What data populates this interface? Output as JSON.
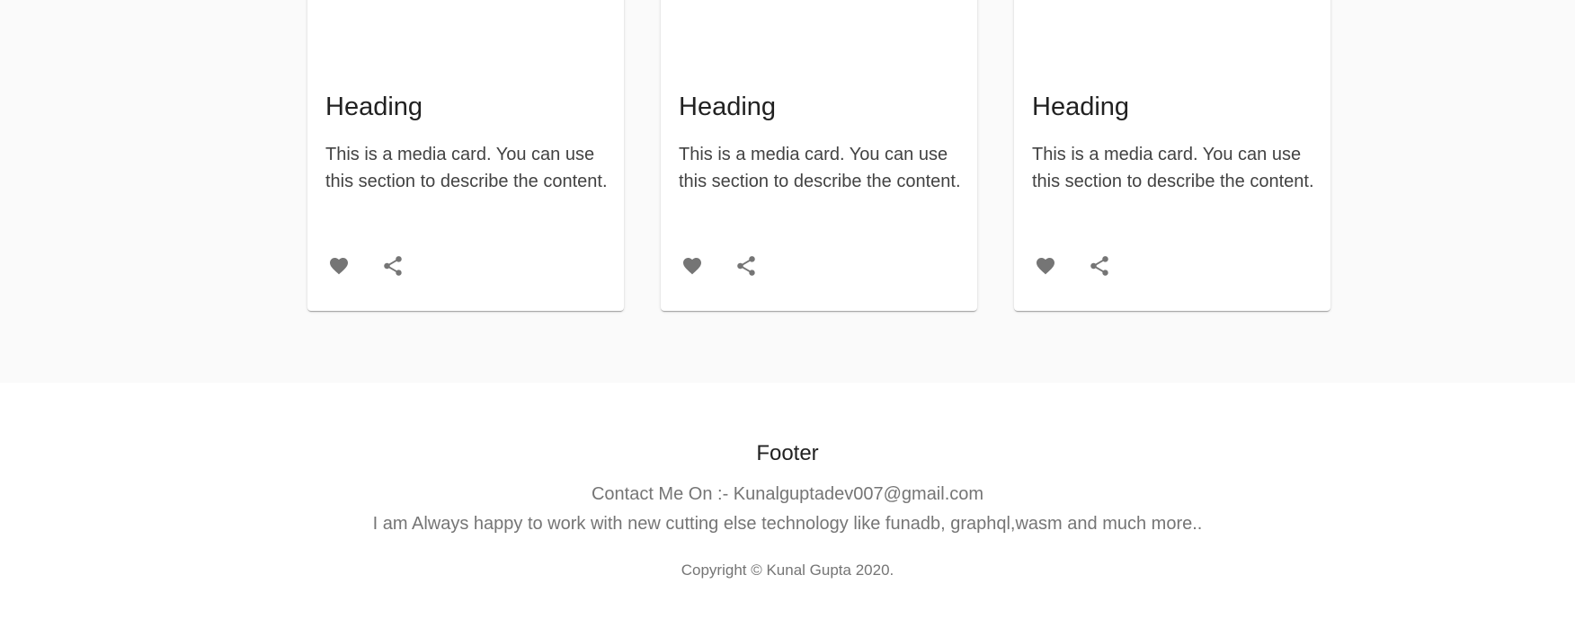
{
  "cards": [
    {
      "heading": "Heading",
      "text": "This is a media card. You can use this section to describe the content."
    },
    {
      "heading": "Heading",
      "text": "This is a media card. You can use this section to describe the content."
    },
    {
      "heading": "Heading",
      "text": "This is a media card. You can use this section to describe the content."
    }
  ],
  "icons": {
    "like": "heart-icon",
    "share": "share-icon"
  },
  "colors": {
    "section_background": "#fafafa",
    "icon": "#757575",
    "heading": "#212121",
    "muted_text": "#757575"
  },
  "footer": {
    "title": "Footer",
    "contact": "Contact Me On :- Kunalguptadev007@gmail.com",
    "description": "I am Always happy to work with new cutting else technology like funadb, graphql,wasm and much more..",
    "copyright": "Copyright © Kunal Gupta 2020."
  }
}
